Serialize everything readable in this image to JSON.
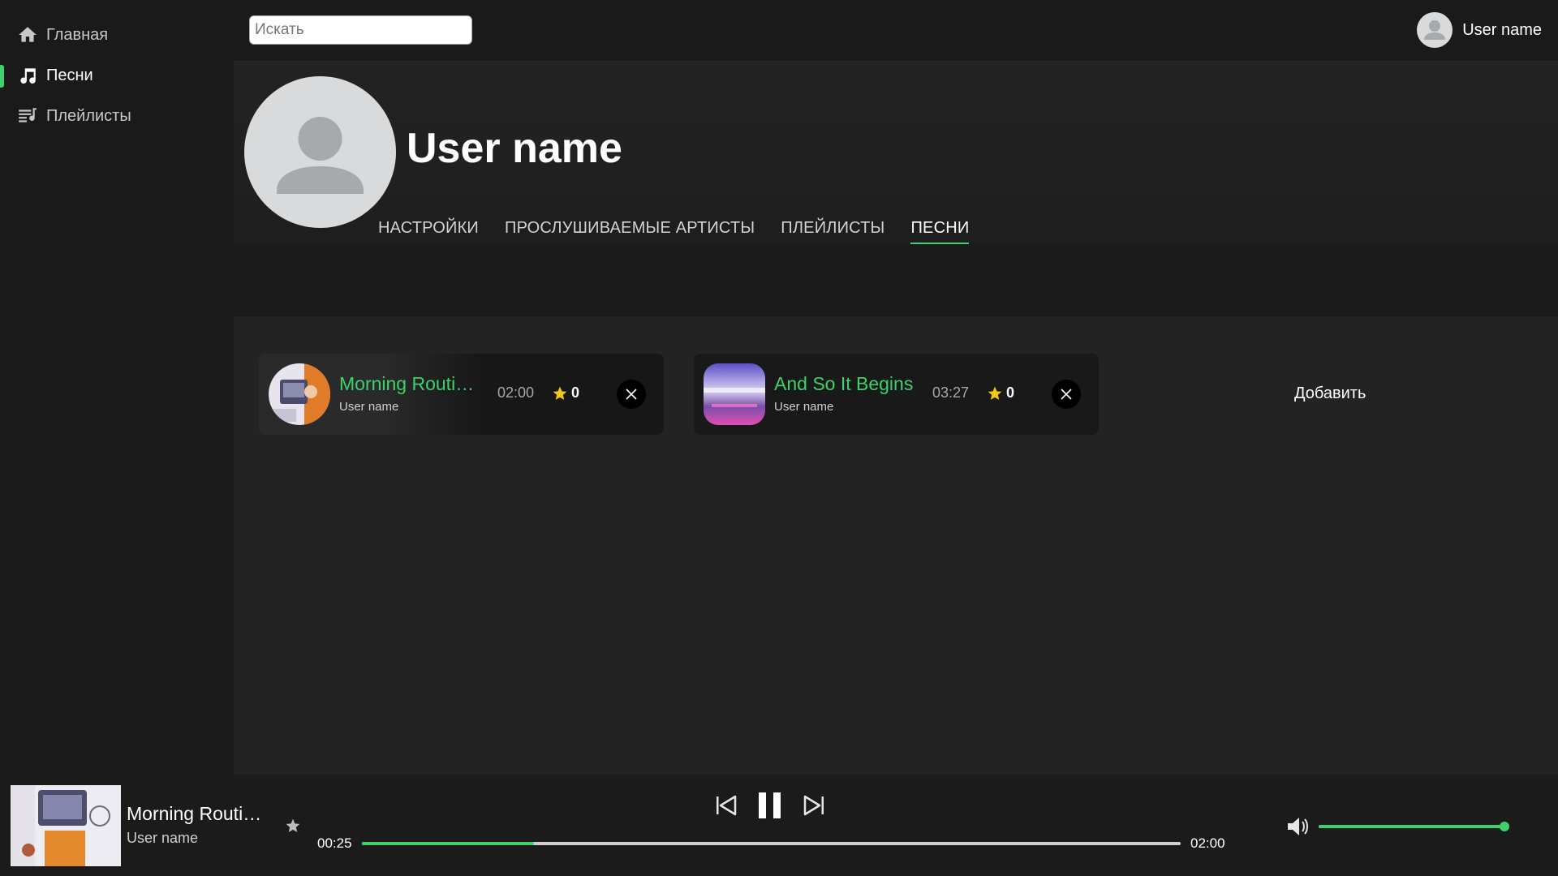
{
  "sidebar": {
    "items": [
      {
        "label": "Главная",
        "icon": "home-icon",
        "active": false
      },
      {
        "label": "Песни",
        "icon": "music-note-icon",
        "active": true
      },
      {
        "label": "Плейлисты",
        "icon": "playlist-icon",
        "active": false
      }
    ]
  },
  "topbar": {
    "search_placeholder": "Искать",
    "user_name": "User name"
  },
  "profile": {
    "name": "User name"
  },
  "tabs": [
    {
      "label": "НАСТРОЙКИ",
      "active": false
    },
    {
      "label": "ПРОСЛУШИВАЕМЫЕ АРТИСТЫ",
      "active": false
    },
    {
      "label": "ПЛЕЙЛИСТЫ",
      "active": false
    },
    {
      "label": "ПЕСНИ",
      "active": true
    }
  ],
  "songs": [
    {
      "title": "Morning Routin...",
      "user": "User name",
      "duration": "02:00",
      "likes": "0"
    },
    {
      "title": "And So It Begins",
      "user": "User name",
      "duration": "03:27",
      "likes": "0"
    }
  ],
  "add_label": "Добавить",
  "player": {
    "title": "Morning Routin...",
    "user": "User name",
    "current_time": "00:25",
    "total_time": "02:00",
    "progress": 0.21,
    "volume": 1.0
  },
  "colors": {
    "accent": "#3ed16b",
    "background": "#1a1a1a",
    "main_bg": "#232323",
    "star": "#f5c518"
  }
}
